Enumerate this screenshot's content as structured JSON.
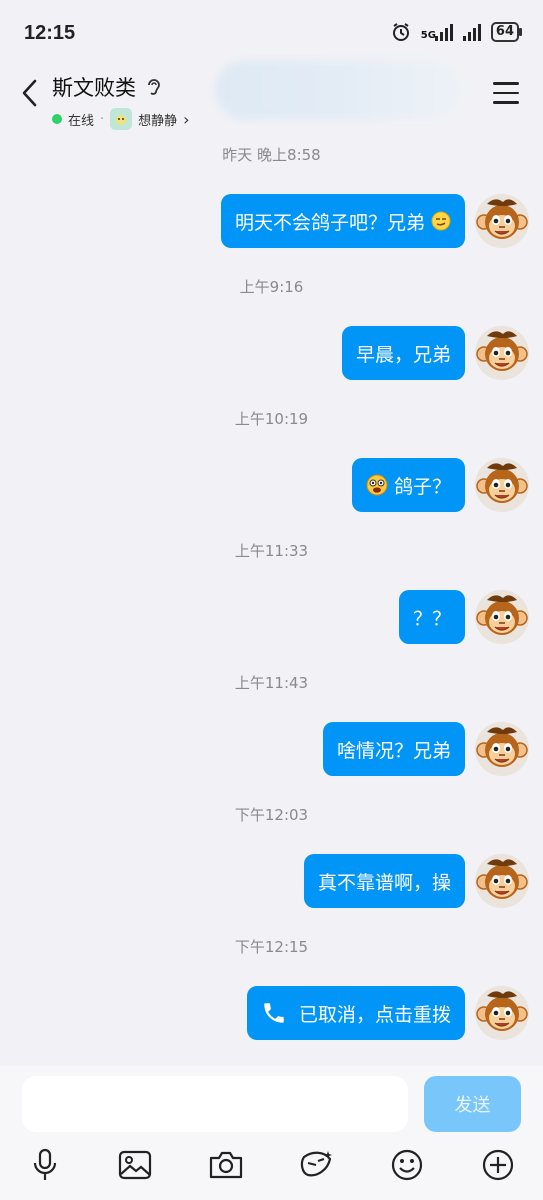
{
  "status_bar": {
    "time": "12:15",
    "network": "5G",
    "battery": "64"
  },
  "header": {
    "contact_name": "斯文败类",
    "online_text": "在线",
    "separator": "·",
    "status_text": "想静静",
    "chevron": "›"
  },
  "messages": [
    {
      "time": "昨天 晚上8:58",
      "text": "明天不会鸽子吧？兄弟",
      "emoji_after": "smirk-emoji"
    },
    {
      "time": "上午9:16",
      "text": "早晨，兄弟"
    },
    {
      "time": "上午10:19",
      "text": "鸽子？",
      "emoji_before": "shocked-emoji"
    },
    {
      "time": "上午11:33",
      "text": "？？"
    },
    {
      "time": "上午11:43",
      "text": "啥情况？兄弟"
    },
    {
      "time": "下午12:03",
      "text": "真不靠谱啊，操"
    },
    {
      "time": "下午12:15",
      "text": "已取消，点击重拨",
      "icon": "phone-icon"
    }
  ],
  "composer": {
    "input_value": "",
    "send_label": "发送"
  },
  "toolbar": [
    "mic-icon",
    "image-icon",
    "camera-icon",
    "sticker-icon",
    "emoji-icon",
    "plus-icon"
  ],
  "colors": {
    "bubble": "#0095f6",
    "send_disabled": "#79c6fb",
    "online": "#2fd16a",
    "background": "#f2f2f6"
  }
}
